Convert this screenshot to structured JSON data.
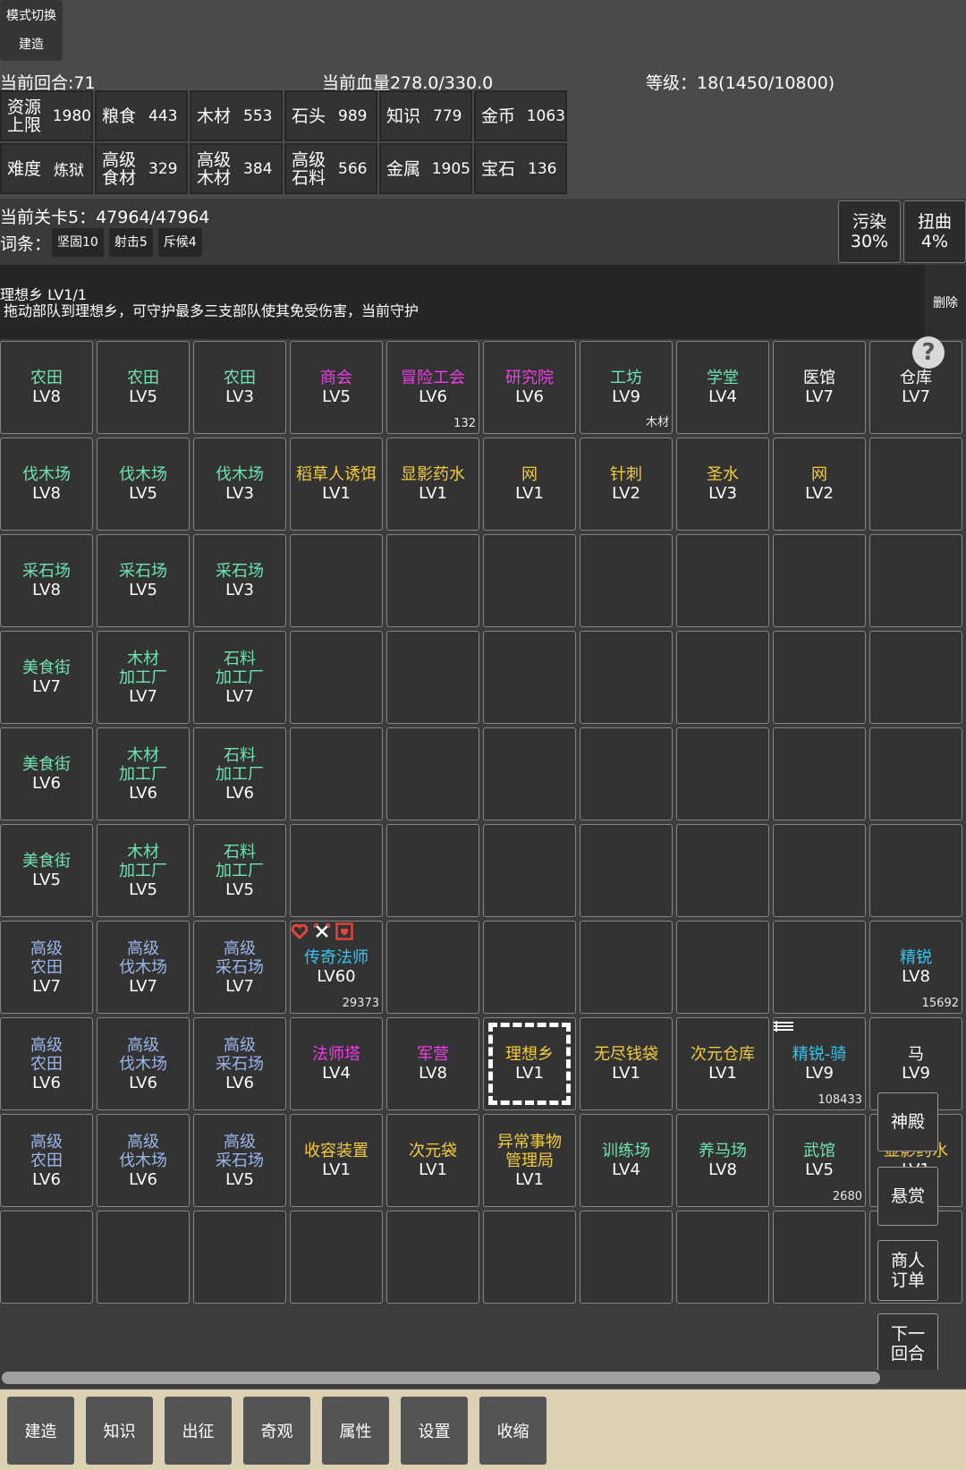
{
  "topbar": {
    "mode_switch": {
      "line1": "模式切换",
      "line2": "建造"
    },
    "turn": "当前回合:71",
    "hp": "当前血量278.0/330.0",
    "level": "等级：18(1450/10800)"
  },
  "resources": [
    {
      "label": "资源\n上限",
      "value": "1980"
    },
    {
      "label": "粮食",
      "value": "443"
    },
    {
      "label": "木材",
      "value": "553"
    },
    {
      "label": "石头",
      "value": "989"
    },
    {
      "label": "知识",
      "value": "779"
    },
    {
      "label": "金币",
      "value": "1063"
    },
    {
      "label": "难度",
      "value": "炼狱"
    },
    {
      "label": "高级\n食材",
      "value": "329"
    },
    {
      "label": "高级\n木材",
      "value": "384"
    },
    {
      "label": "高级\n石料",
      "value": "566"
    },
    {
      "label": "金属",
      "value": "1905"
    },
    {
      "label": "宝石",
      "value": "136"
    }
  ],
  "stage": {
    "title": "当前关卡5：47964/47964",
    "affix_label": "词条：",
    "affixes": [
      "坚固10",
      "射击5",
      "斥候4"
    ],
    "pollution": {
      "label": "污染",
      "value": "30%"
    },
    "twist": {
      "label": "扭曲",
      "value": "4%"
    }
  },
  "info": {
    "title": "理想乡 LV1/1",
    "desc": "拖动部队到理想乡，可守护最多三支部队使其免受伤害，当前守护",
    "delete": "删除"
  },
  "colors": {
    "green": "#6fe3b0",
    "magenta": "#ee3ee6",
    "yellow": "#f2cc3e",
    "white": "#ffffff",
    "blue": "#9bb6e9",
    "cyan": "#35c5f0"
  },
  "grid": [
    [
      {
        "name": "农田",
        "lv": "LV8",
        "color": "#6fe3b0"
      },
      {
        "name": "农田",
        "lv": "LV5",
        "color": "#6fe3b0"
      },
      {
        "name": "农田",
        "lv": "LV3",
        "color": "#6fe3b0"
      },
      {
        "name": "商会",
        "lv": "LV5",
        "color": "#ee3ee6"
      },
      {
        "name": "冒险工会",
        "lv": "LV6",
        "color": "#ee3ee6",
        "num": "132"
      },
      {
        "name": "研究院",
        "lv": "LV6",
        "color": "#ee3ee6"
      },
      {
        "name": "工坊",
        "lv": "LV9",
        "color": "#6fe3b0",
        "res": "木材"
      },
      {
        "name": "学堂",
        "lv": "LV4",
        "color": "#6fe3b0"
      },
      {
        "name": "医馆",
        "lv": "LV7",
        "color": "#ffffff"
      },
      {
        "name": "仓库",
        "lv": "LV7",
        "color": "#ffffff"
      }
    ],
    [
      {
        "name": "伐木场",
        "lv": "LV8",
        "color": "#6fe3b0"
      },
      {
        "name": "伐木场",
        "lv": "LV5",
        "color": "#6fe3b0"
      },
      {
        "name": "伐木场",
        "lv": "LV3",
        "color": "#6fe3b0"
      },
      {
        "name": "稻草人诱饵",
        "lv": "LV1",
        "color": "#f2cc3e"
      },
      {
        "name": "显影药水",
        "lv": "LV1",
        "color": "#f2cc3e"
      },
      {
        "name": "网",
        "lv": "LV1",
        "color": "#f2cc3e"
      },
      {
        "name": "针刺",
        "lv": "LV2",
        "color": "#f2cc3e"
      },
      {
        "name": "圣水",
        "lv": "LV3",
        "color": "#f2cc3e"
      },
      {
        "name": "网",
        "lv": "LV2",
        "color": "#f2cc3e"
      },
      {}
    ],
    [
      {
        "name": "采石场",
        "lv": "LV8",
        "color": "#6fe3b0"
      },
      {
        "name": "采石场",
        "lv": "LV5",
        "color": "#6fe3b0"
      },
      {
        "name": "采石场",
        "lv": "LV3",
        "color": "#6fe3b0"
      },
      {},
      {},
      {},
      {},
      {},
      {},
      {}
    ],
    [
      {
        "name": "美食街",
        "lv": "LV7",
        "color": "#6fe3b0"
      },
      {
        "name": "木材\n加工厂",
        "lv": "LV7",
        "color": "#6fe3b0"
      },
      {
        "name": "石料\n加工厂",
        "lv": "LV7",
        "color": "#6fe3b0"
      },
      {},
      {},
      {},
      {},
      {},
      {},
      {}
    ],
    [
      {
        "name": "美食街",
        "lv": "LV6",
        "color": "#6fe3b0"
      },
      {
        "name": "木材\n加工厂",
        "lv": "LV6",
        "color": "#6fe3b0"
      },
      {
        "name": "石料\n加工厂",
        "lv": "LV6",
        "color": "#6fe3b0"
      },
      {},
      {},
      {},
      {},
      {},
      {},
      {}
    ],
    [
      {
        "name": "美食街",
        "lv": "LV5",
        "color": "#6fe3b0"
      },
      {
        "name": "木材\n加工厂",
        "lv": "LV5",
        "color": "#6fe3b0"
      },
      {
        "name": "石料\n加工厂",
        "lv": "LV5",
        "color": "#6fe3b0"
      },
      {},
      {},
      {},
      {},
      {},
      {},
      {}
    ],
    [
      {
        "name": "高级\n农田",
        "lv": "LV7",
        "color": "#9bb6e9"
      },
      {
        "name": "高级\n伐木场",
        "lv": "LV7",
        "color": "#9bb6e9"
      },
      {
        "name": "高级\n采石场",
        "lv": "LV7",
        "color": "#9bb6e9"
      },
      {
        "name": "传奇法师",
        "lv": "LV60",
        "color": "#35c5f0",
        "num": "29373"
      },
      {},
      {},
      {},
      {},
      {},
      {
        "name": "精锐",
        "lv": "LV8",
        "color": "#35c5f0",
        "num": "15692"
      }
    ],
    [
      {
        "name": "高级\n农田",
        "lv": "LV6",
        "color": "#9bb6e9"
      },
      {
        "name": "高级\n伐木场",
        "lv": "LV6",
        "color": "#9bb6e9"
      },
      {
        "name": "高级\n采石场",
        "lv": "LV6",
        "color": "#9bb6e9"
      },
      {
        "name": "法师塔",
        "lv": "LV4",
        "color": "#ee3ee6"
      },
      {
        "name": "军营",
        "lv": "LV8",
        "color": "#ee3ee6"
      },
      {
        "name": "理想乡",
        "lv": "LV1",
        "color": "#f2cc3e",
        "selected": true
      },
      {
        "name": "无尽钱袋",
        "lv": "LV1",
        "color": "#f2cc3e"
      },
      {
        "name": "次元仓库",
        "lv": "LV1",
        "color": "#f2cc3e"
      },
      {
        "name": "精锐-骑",
        "lv": "LV9",
        "color": "#35c5f0",
        "num": "108433"
      },
      {
        "name": "马",
        "lv": "LV9",
        "color": "#ffffff"
      }
    ],
    [
      {
        "name": "高级\n农田",
        "lv": "LV6",
        "color": "#9bb6e9"
      },
      {
        "name": "高级\n伐木场",
        "lv": "LV6",
        "color": "#9bb6e9"
      },
      {
        "name": "高级\n采石场",
        "lv": "LV5",
        "color": "#9bb6e9"
      },
      {
        "name": "收容装置",
        "lv": "LV1",
        "color": "#f2cc3e"
      },
      {
        "name": "次元袋",
        "lv": "LV1",
        "color": "#f2cc3e"
      },
      {
        "name": "异常事物\n管理局",
        "lv": "LV1",
        "color": "#f2cc3e"
      },
      {
        "name": "训练场",
        "lv": "LV4",
        "color": "#6fe3b0"
      },
      {
        "name": "养马场",
        "lv": "LV8",
        "color": "#6fe3b0"
      },
      {
        "name": "武馆",
        "lv": "LV5",
        "color": "#6fe3b0",
        "num": "2680"
      },
      {
        "name": "显影药水",
        "lv": "LV1",
        "color": "#f2cc3e"
      }
    ],
    [
      {},
      {},
      {},
      {},
      {},
      {},
      {},
      {},
      {},
      {}
    ]
  ],
  "side_buttons": {
    "shrine": "神殿",
    "bounty": "悬赏",
    "merchant": "商人\n订单",
    "next_turn": "下一\n回合"
  },
  "bottom_nav": [
    "建造",
    "知识",
    "出征",
    "奇观",
    "属性",
    "设置",
    "收缩"
  ],
  "unit_icons": [
    "heart-icon",
    "crossed-swords-icon",
    "shield-box-icon"
  ]
}
